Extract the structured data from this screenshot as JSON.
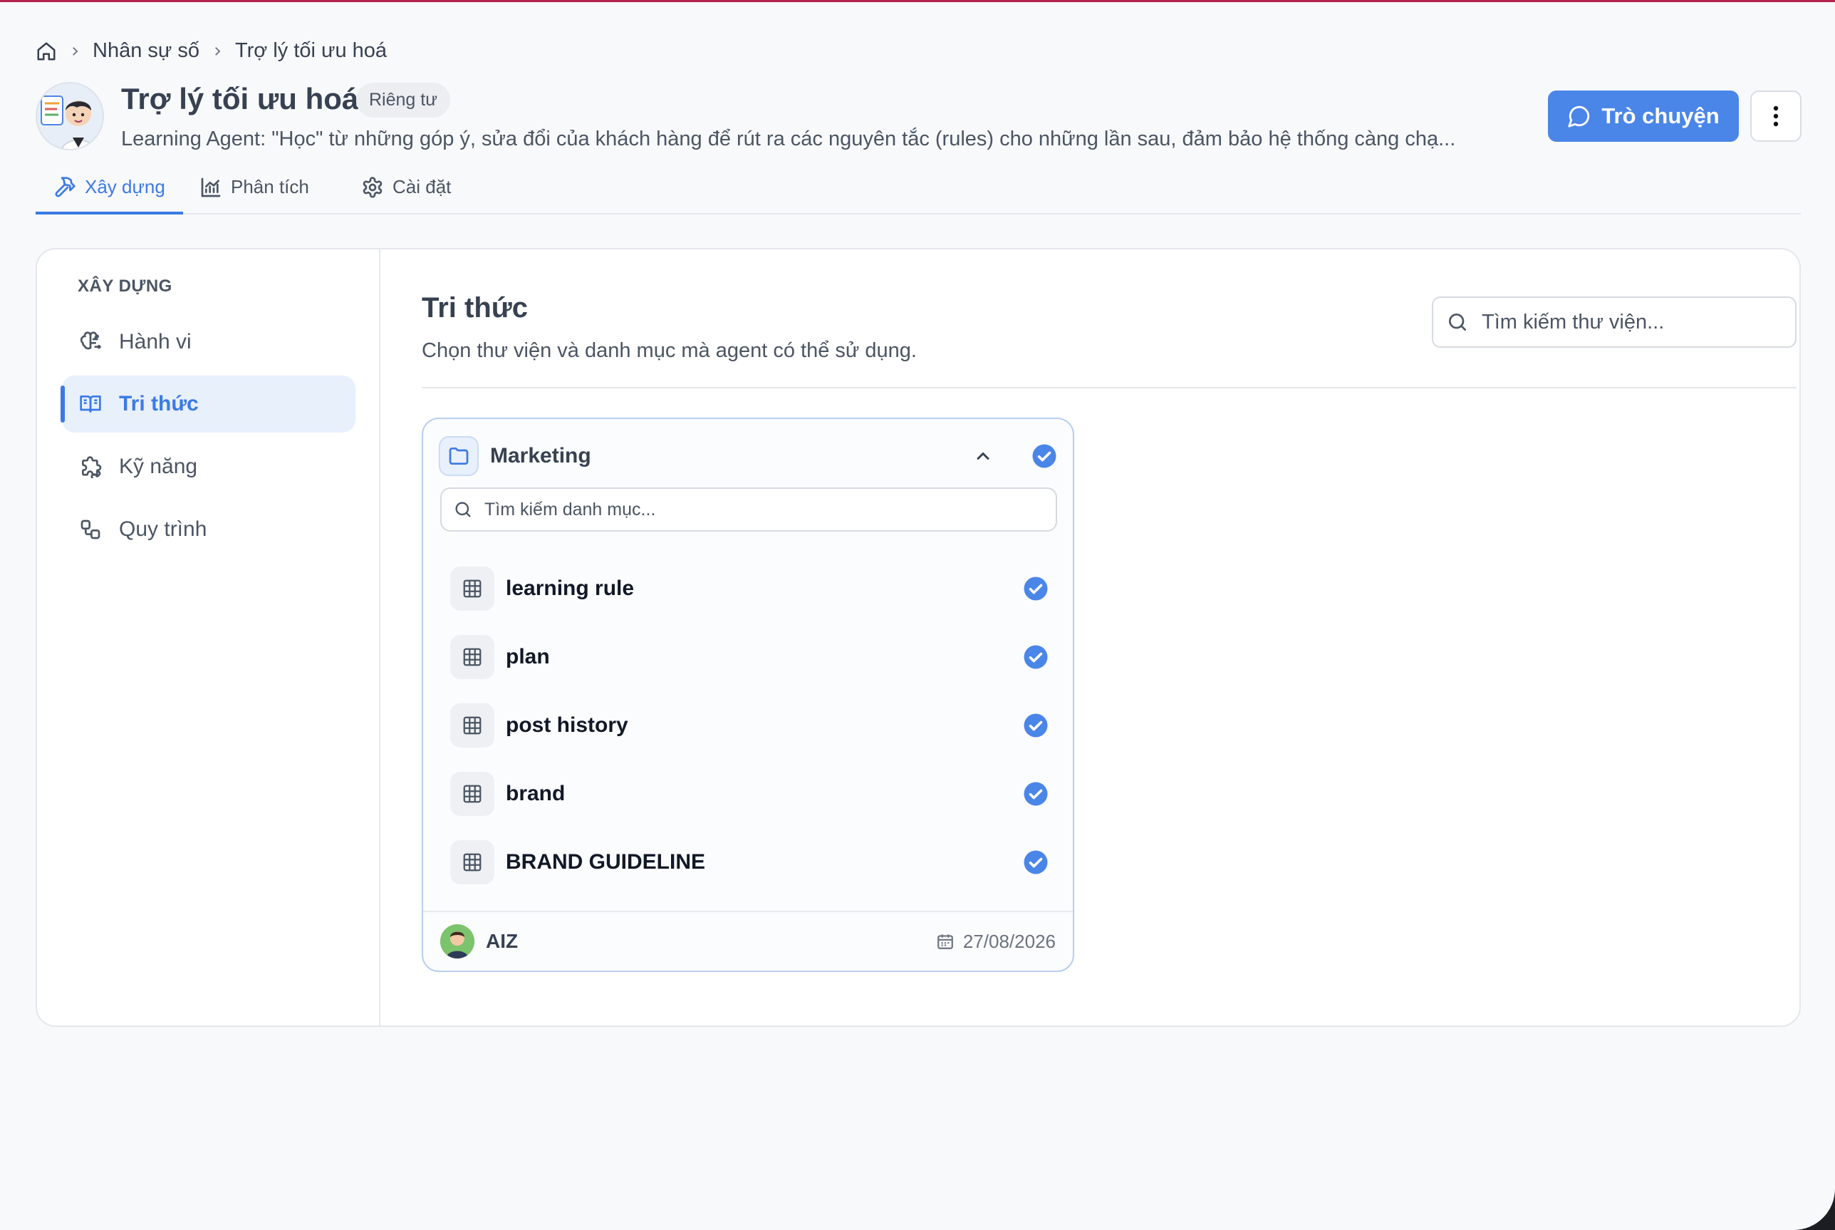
{
  "breadcrumb": {
    "home_icon": "home-icon",
    "items": [
      "Nhân sự số",
      "Trợ lý tối ưu hoá"
    ]
  },
  "header": {
    "title": "Trợ lý tối ưu hoá",
    "badge": "Riêng tư",
    "description": "Learning Agent: \"Học\" từ những góp ý, sửa đổi của khách hàng để rút ra các nguyên tắc (rules) cho những lần sau, đảm bảo hệ thống càng chạ...",
    "chat_button": "Trò chuyện"
  },
  "tabs": [
    {
      "label": "Xây dựng",
      "icon": "hammer-icon",
      "active": true
    },
    {
      "label": "Phân tích",
      "icon": "chart-icon",
      "active": false
    },
    {
      "label": "Cài đặt",
      "icon": "gear-icon",
      "active": false
    }
  ],
  "sidebar": {
    "heading": "XÂY DỰNG",
    "items": [
      {
        "label": "Hành vi",
        "icon": "brain-icon"
      },
      {
        "label": "Tri thức",
        "icon": "book-icon",
        "active": true
      },
      {
        "label": "Kỹ năng",
        "icon": "puzzle-icon"
      },
      {
        "label": "Quy trình",
        "icon": "workflow-icon"
      }
    ]
  },
  "content": {
    "title": "Tri thức",
    "subtitle": "Chọn thư viện và danh mục mà agent có thể sử dụng.",
    "search_placeholder": "Tìm kiếm thư viện..."
  },
  "library": {
    "name": "Marketing",
    "selected": true,
    "category_search_placeholder": "Tìm kiếm danh mục...",
    "categories": [
      {
        "label": "learning rule",
        "checked": true
      },
      {
        "label": "plan",
        "checked": true
      },
      {
        "label": "post history",
        "checked": true
      },
      {
        "label": "brand",
        "checked": true
      },
      {
        "label": "BRAND GUIDELINE",
        "checked": true
      }
    ],
    "owner": "AIZ",
    "date": "27/08/2026"
  },
  "colors": {
    "accent": "#4a86e8",
    "active_tab": "#3b7ae4",
    "top_line": "#b3244a"
  }
}
